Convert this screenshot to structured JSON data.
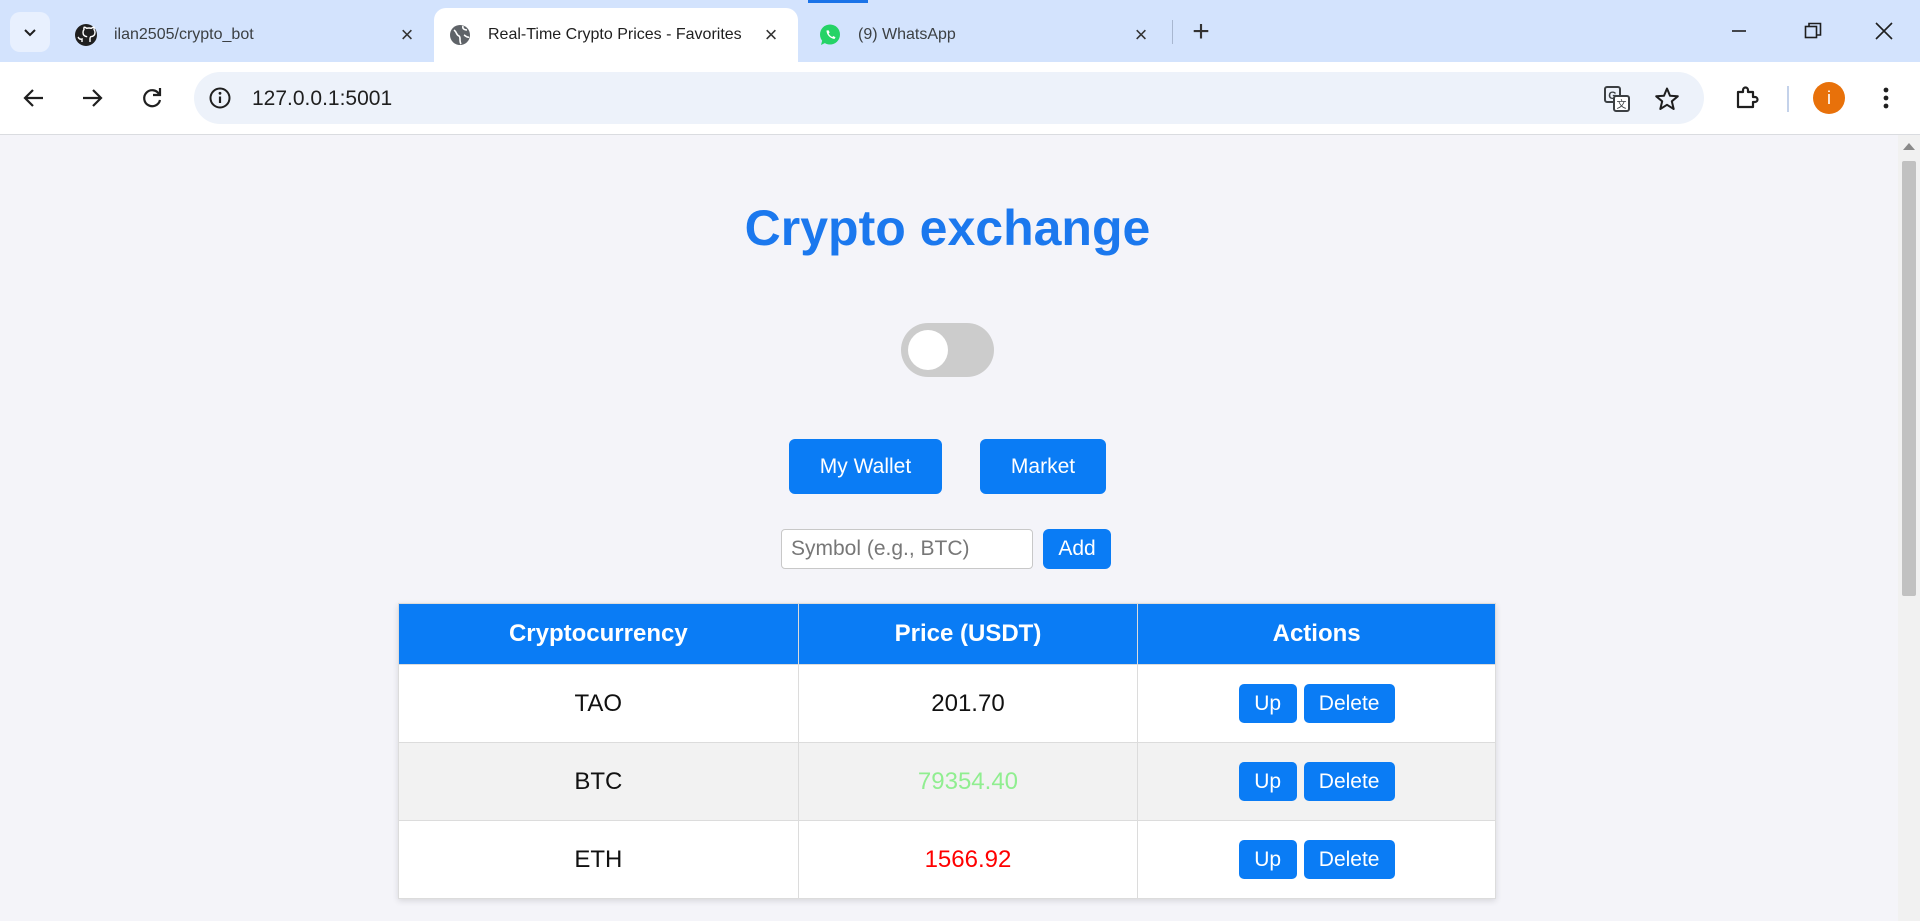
{
  "browser": {
    "tabs": [
      {
        "title": "ilan2505/crypto_bot",
        "icon": "github-icon"
      },
      {
        "title": "Real-Time Crypto Prices - Favorites",
        "icon": "globe-icon"
      },
      {
        "title": "(9) WhatsApp",
        "icon": "whatsapp-icon"
      }
    ],
    "url": "127.0.0.1:5001",
    "profile_initial": "i",
    "colors": {
      "tabstrip": "#d3e3fd",
      "avatar": "#e8710a",
      "whatsapp": "#25d366"
    }
  },
  "page": {
    "title": "Crypto exchange",
    "wallet_label": "My Wallet",
    "market_label": "Market",
    "symbol_placeholder": "Symbol (e.g., BTC)",
    "add_label": "Add",
    "table": {
      "headers": [
        "Cryptocurrency",
        "Price (USDT)",
        "Actions"
      ],
      "rows": [
        {
          "symbol": "TAO",
          "price": "201.70",
          "price_color": "#111111"
        },
        {
          "symbol": "BTC",
          "price": "79354.40",
          "price_color": "#90ee90"
        },
        {
          "symbol": "ETH",
          "price": "1566.92",
          "price_color": "#ff0000"
        }
      ],
      "up_label": "Up",
      "delete_label": "Delete"
    },
    "colors": {
      "accent": "#0a7cf5",
      "title": "#1b78ee"
    },
    "toggle_on": false
  }
}
